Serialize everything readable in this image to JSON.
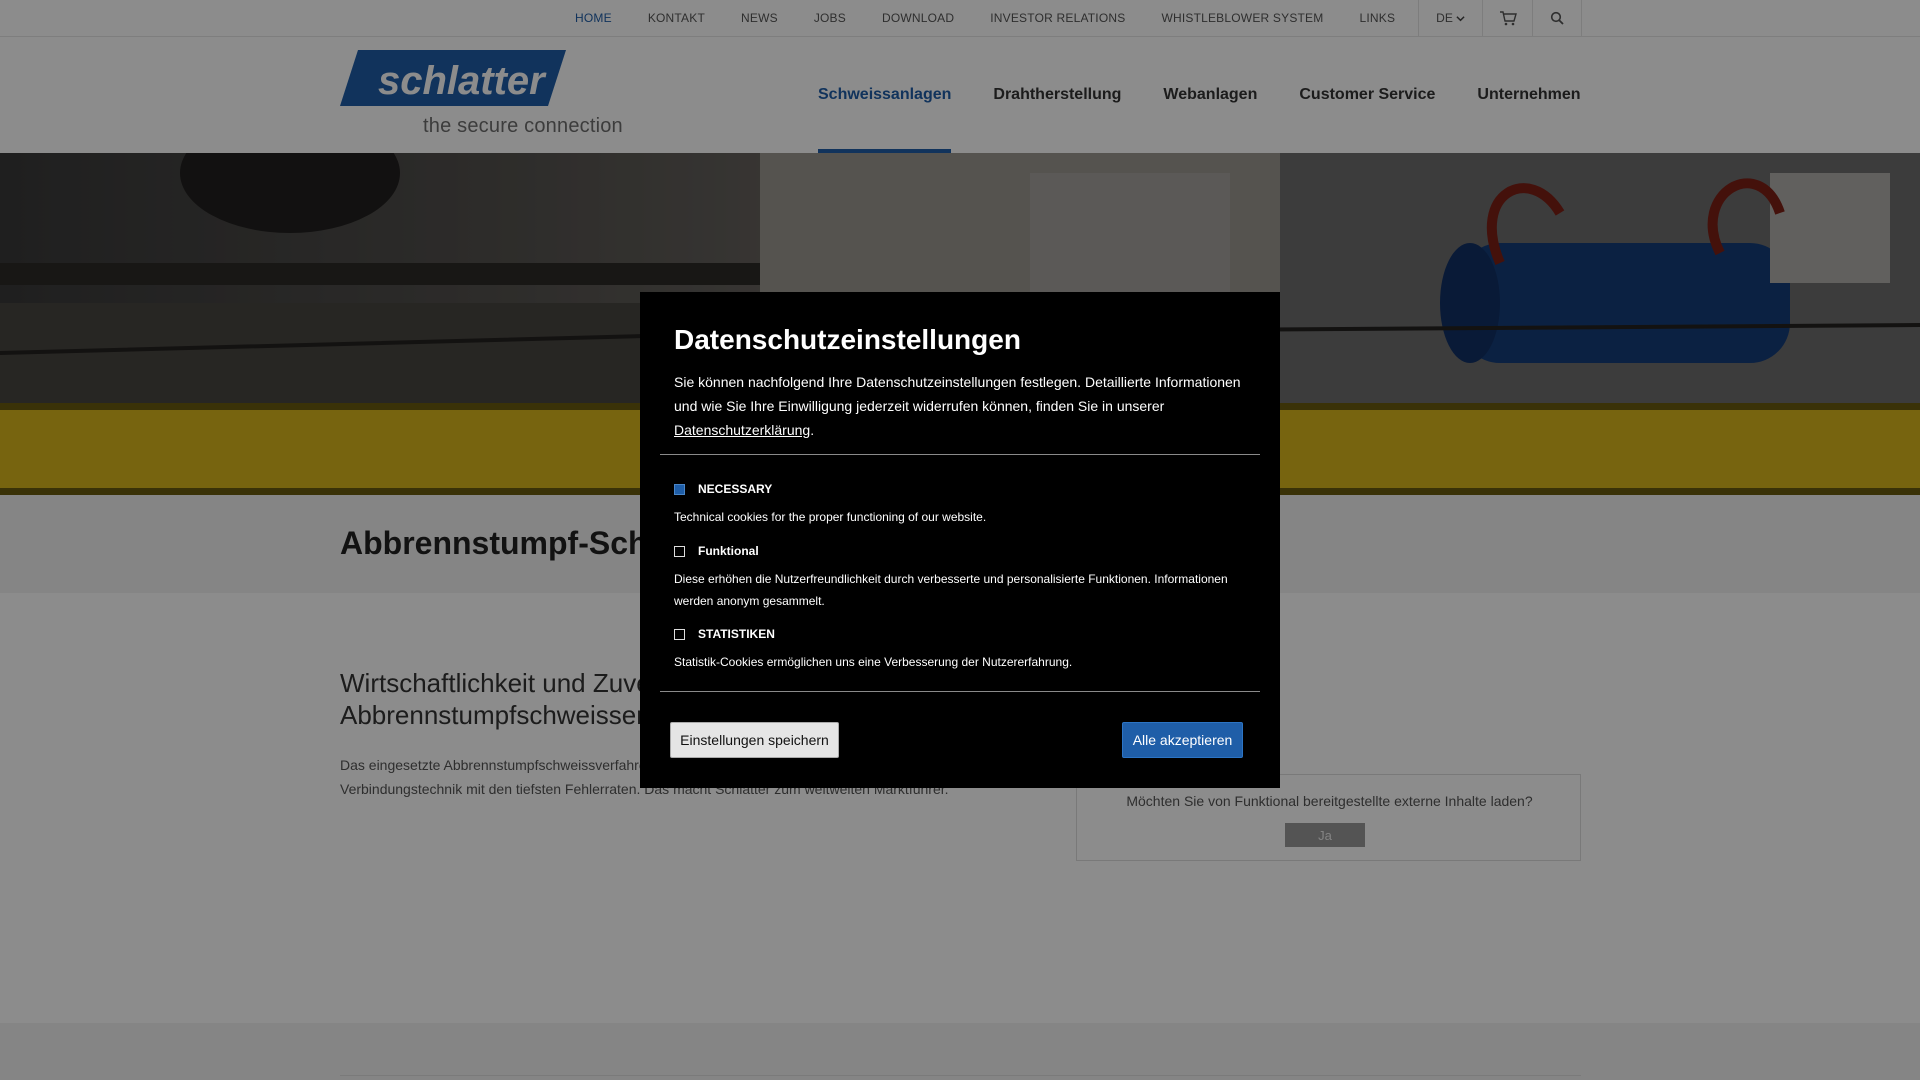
{
  "topbar": {
    "links": [
      {
        "label": "HOME",
        "active": true
      },
      {
        "label": "KONTAKT"
      },
      {
        "label": "NEWS"
      },
      {
        "label": "JOBS"
      },
      {
        "label": "DOWNLOAD"
      },
      {
        "label": "INVESTOR RELATIONS"
      },
      {
        "label": "WHISTLEBLOWER SYSTEM"
      },
      {
        "label": "LINKS"
      }
    ],
    "language": "DE",
    "cart_icon": "cart-icon",
    "search_icon": "search-icon"
  },
  "header": {
    "logo_text": "schlatter",
    "tagline": "the secure connection",
    "nav": [
      {
        "label": "Schweissanlagen",
        "active": true
      },
      {
        "label": "Drahtherstellung"
      },
      {
        "label": "Webanlagen"
      },
      {
        "label": "Customer Service"
      },
      {
        "label": "Unternehmen"
      }
    ]
  },
  "page": {
    "title": "Abbrennstumpf-Sch",
    "heading": "Wirtschaftlichkeit und Zuve\nAbbrennstumpfschweisser",
    "intro": "Das eingesetzte Abbrennstumpfschweissverfahre\nVerbindungstechnik mit den tiefsten Fehlerraten. Das macht Schlatter zum weltweiten Marktführer."
  },
  "external_content": {
    "question": "Möchten Sie von Funktional bereitgestellte externe Inhalte laden?",
    "button": "Ja"
  },
  "privacy_modal": {
    "title": "Datenschutzeinstellungen",
    "intro_before_link": "Sie können nachfolgend Ihre Datenschutzeinstellungen festlegen. Detaillierte Informationen und wie Sie Ihre Einwilligung jederzeit widerrufen können, finden Sie in unserer ",
    "intro_link": "Datenschutzerklärung",
    "intro_after_link": ".",
    "options": [
      {
        "label": "NECESSARY",
        "checked": true,
        "description": "Technical cookies for the proper functioning of our website."
      },
      {
        "label": "Funktional",
        "checked": false,
        "description": "Diese erhöhen die Nutzerfreundlichkeit durch verbesserte und personalisierte Funktionen. Informationen werden anonym gesammelt."
      },
      {
        "label": "STATISTIKEN",
        "checked": false,
        "description": "Statistik-Cookies ermöglichen uns eine Verbesserung der Nutzererfahrung."
      }
    ],
    "save_button": "Einstellungen speichern",
    "accept_button": "Alle akzeptieren"
  },
  "colors": {
    "brand_blue": "#1f5ea8",
    "band_yellow": "#d9b61c",
    "modal_bg": "#000000"
  }
}
